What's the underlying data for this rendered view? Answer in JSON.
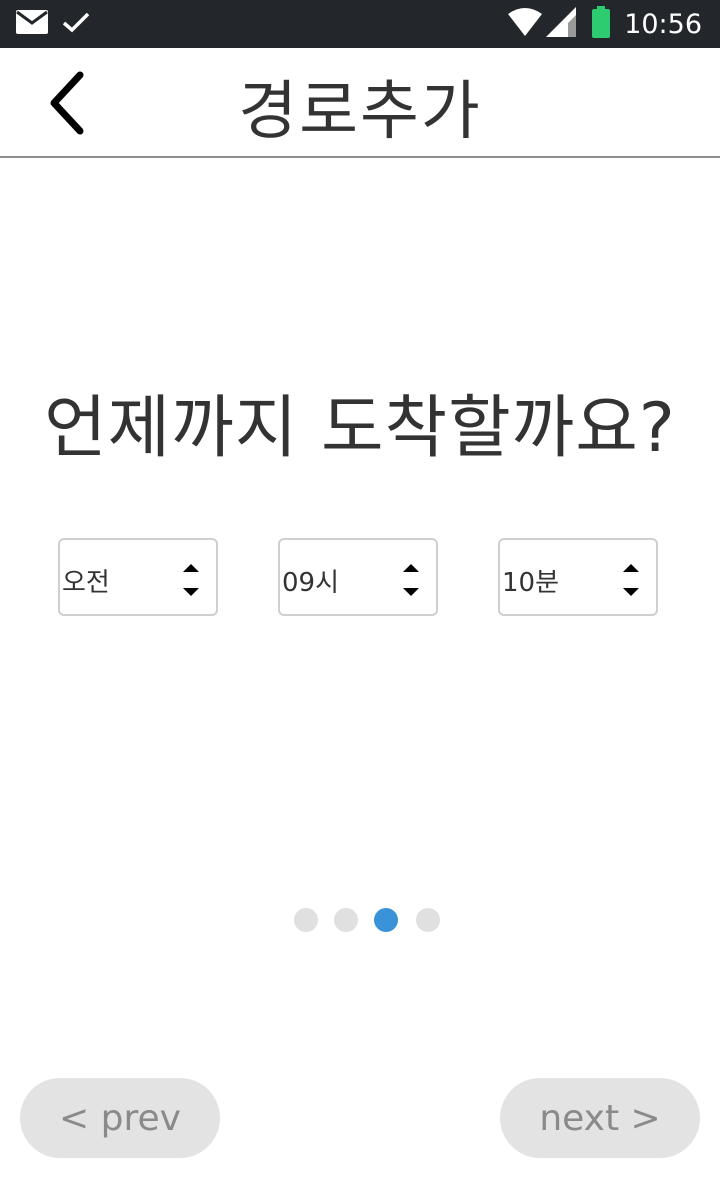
{
  "status_bar": {
    "time": "10:56",
    "icons": [
      "mail-icon",
      "check-icon",
      "wifi-icon",
      "signal-icon",
      "battery-icon"
    ],
    "colors": {
      "background": "#23272b",
      "battery": "#2ecc71"
    }
  },
  "header": {
    "title": "경로추가",
    "back_icon": "chevron-left-icon"
  },
  "main": {
    "question": "언제까지 도착할까요?",
    "selects": [
      {
        "value": "오전"
      },
      {
        "value": "09시"
      },
      {
        "value": "10분"
      }
    ]
  },
  "pager": {
    "total": 4,
    "active_index": 2,
    "colors": {
      "active": "#3a93d8",
      "inactive": "#e0e0e0"
    }
  },
  "footer": {
    "prev_label": "< prev",
    "next_label": "next >"
  }
}
